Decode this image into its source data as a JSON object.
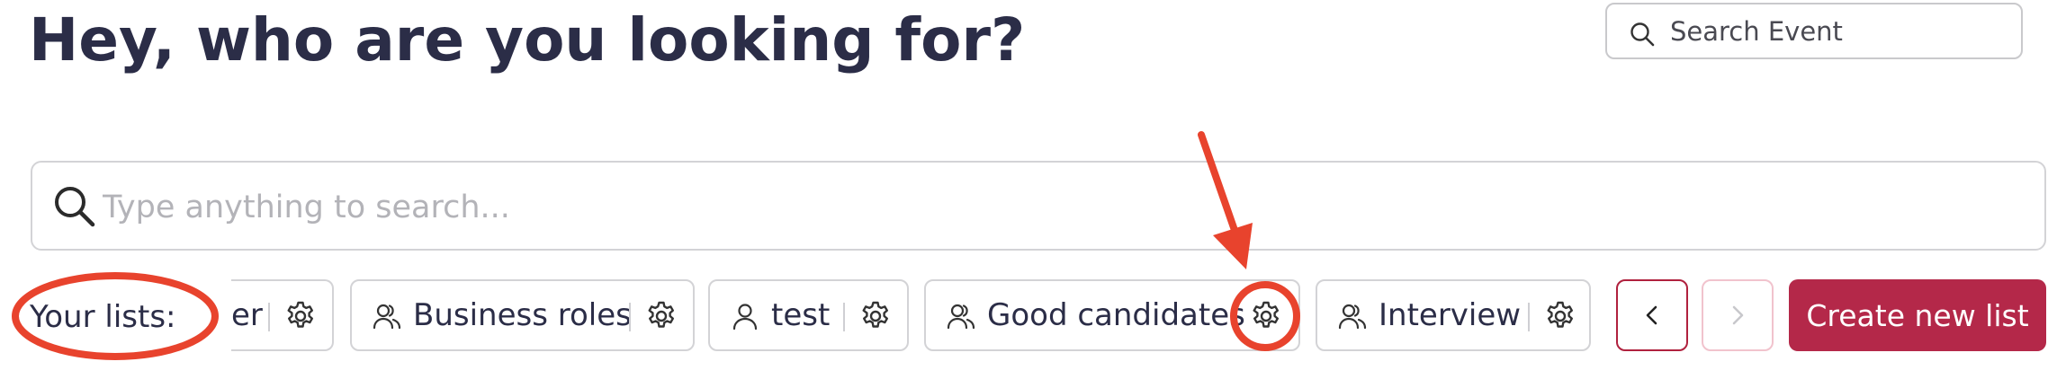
{
  "header": {
    "title": "Hey, who are you looking for?"
  },
  "event_search": {
    "placeholder": "Search Event",
    "icon": "search-icon"
  },
  "main_search": {
    "placeholder": "Type anything to search...",
    "icon": "search-icon"
  },
  "lists": {
    "label": "Your lists:",
    "items": [
      {
        "label": "er",
        "icon": "user-group-icon"
      },
      {
        "label": "Business roles",
        "icon": "user-group-icon"
      },
      {
        "label": "test",
        "icon": "user-icon"
      },
      {
        "label": "Good candidates",
        "icon": "user-group-icon"
      },
      {
        "label": "Interview",
        "icon": "user-group-icon"
      }
    ],
    "prev_label": "<",
    "next_label": ">",
    "create_label": "Create new list"
  },
  "colors": {
    "title": "#2b2d47",
    "accent": "#b42849",
    "border": "#d3d3d6",
    "annotation": "#e8432d"
  }
}
